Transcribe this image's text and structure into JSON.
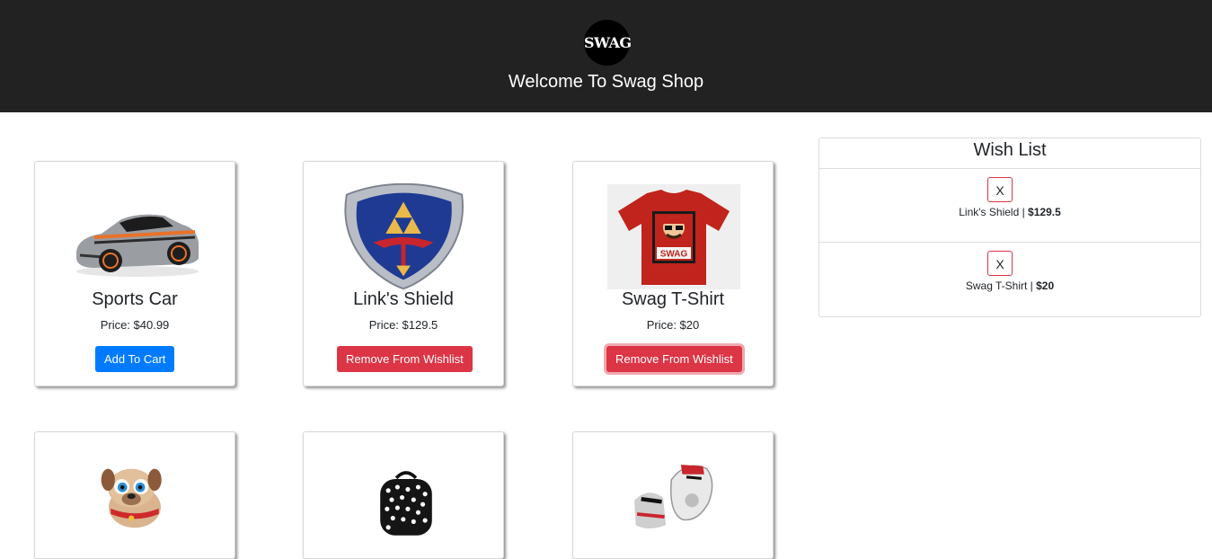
{
  "header": {
    "logo_text": "SWAG",
    "title": "Welcome To Swag Shop",
    "background": "#222222"
  },
  "products": [
    {
      "name": "Sports Car",
      "price": "Price: $40.99",
      "button_label": "Add To Cart",
      "image": "sports-car-image"
    },
    {
      "name": "Link's Shield",
      "price": "Price: $129.5",
      "button_label": "Remove From Wishlist",
      "image": "shield-image"
    },
    {
      "name": "Swag T-Shirt",
      "price": "Price: $20",
      "button_label": "Remove From Wishlist",
      "image": "tshirt-image"
    },
    {
      "image": "puppy-toy-image"
    },
    {
      "image": "backpack-image"
    },
    {
      "image": "sneakers-image"
    }
  ],
  "wishlist": {
    "title": "Wish List",
    "remove_label": "X",
    "items": [
      {
        "name": "Link's Shield",
        "separator": " | ",
        "price": "$129.5"
      },
      {
        "name": "Swag T-Shirt",
        "separator": " | ",
        "price": "$20"
      }
    ]
  },
  "colors": {
    "primary": "#007bff",
    "danger": "#dc3545"
  }
}
